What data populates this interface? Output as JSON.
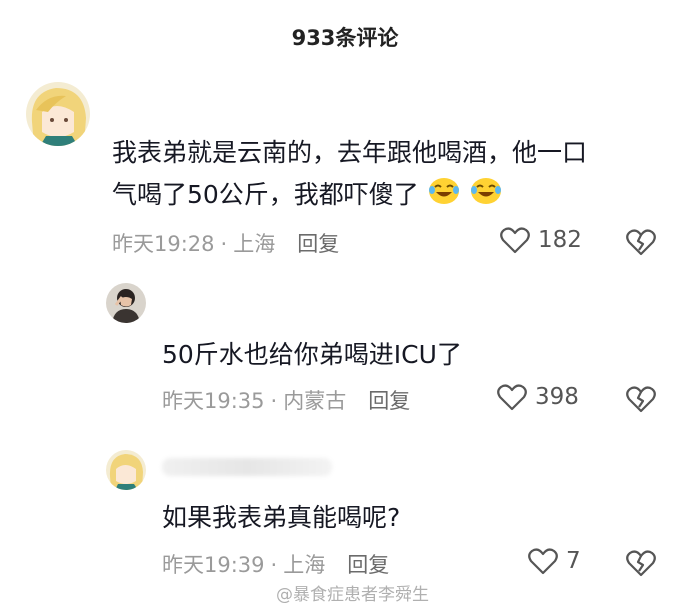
{
  "header": {
    "title": "933条评论"
  },
  "comments": [
    {
      "text_line1": "我表弟就是云南的，去年跟他喝酒，他一口",
      "text_line2": "气喝了50公斤，我都吓傻了",
      "time": "昨天19:28",
      "location": "上海",
      "reply_label": "回复",
      "likes": "182"
    },
    {
      "text": "50斤水也给你弟喝进ICU了",
      "time": "昨天19:35",
      "location": "内蒙古",
      "reply_label": "回复",
      "likes": "398"
    },
    {
      "text": "如果我表弟真能喝呢?",
      "time": "昨天19:39",
      "location": "上海",
      "reply_label": "回复",
      "likes": "7"
    }
  ],
  "watermark": "@暴食症患者李舜生",
  "icons": [
    "heart-outline-icon",
    "broken-heart-icon",
    "laugh-cry-emoji"
  ],
  "colors": {
    "text": "#161823",
    "meta": "#9a9a9a",
    "icon": "#555555"
  }
}
